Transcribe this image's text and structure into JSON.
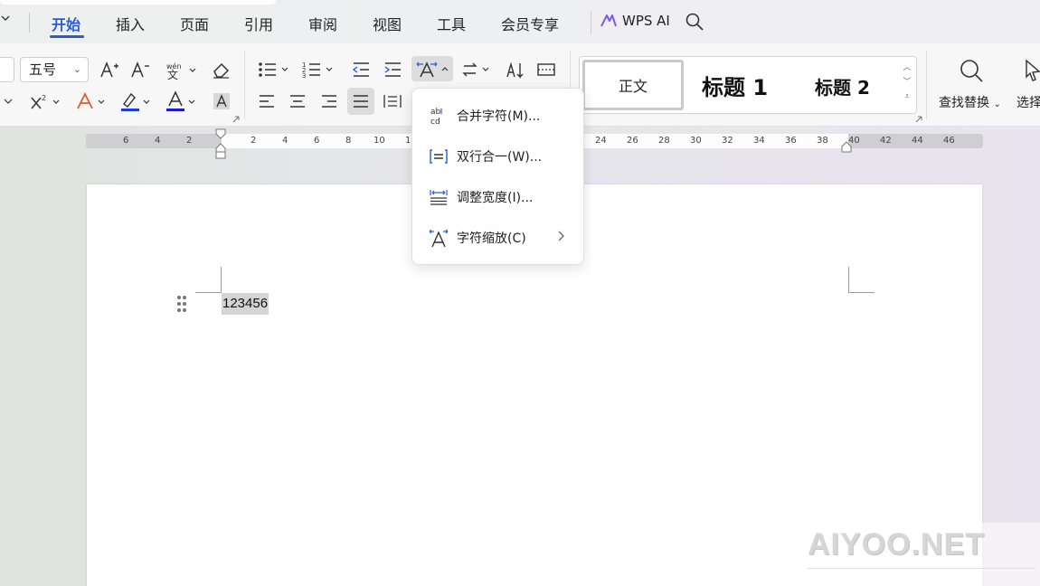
{
  "tabs": {
    "items": [
      "开始",
      "插入",
      "页面",
      "引用",
      "审阅",
      "视图",
      "工具",
      "会员专享"
    ],
    "active": "开始",
    "wps_ai": "WPS AI"
  },
  "ribbon": {
    "font_size": "五号",
    "styles": {
      "normal": "正文",
      "heading1": "标题 1",
      "heading2": "标题 2"
    },
    "find_replace": "查找替换",
    "select": "选择"
  },
  "ruler": {
    "left_ticks": [
      "6",
      "4",
      "2"
    ],
    "right_ticks": [
      "2",
      "4",
      "6",
      "8",
      "10",
      "1"
    ],
    "far_ticks": [
      "24",
      "26",
      "28",
      "30",
      "32",
      "34",
      "36",
      "38",
      "40",
      "42",
      "44",
      "46"
    ]
  },
  "document": {
    "selected_text": "123456"
  },
  "menu": {
    "items": [
      {
        "label": "合并字符(M)...",
        "icon": "combine-characters-icon"
      },
      {
        "label": "双行合一(W)...",
        "icon": "two-lines-in-one-icon"
      },
      {
        "label": "调整宽度(I)...",
        "icon": "adjust-width-icon"
      },
      {
        "label": "字符缩放(C)",
        "icon": "character-scaling-icon",
        "submenu": true
      }
    ]
  },
  "watermark": "AIYOO.NET",
  "colors": {
    "accent": "#2a5bd7",
    "highlight": "#1a3fd6",
    "font_color": "#1a1ad6"
  }
}
